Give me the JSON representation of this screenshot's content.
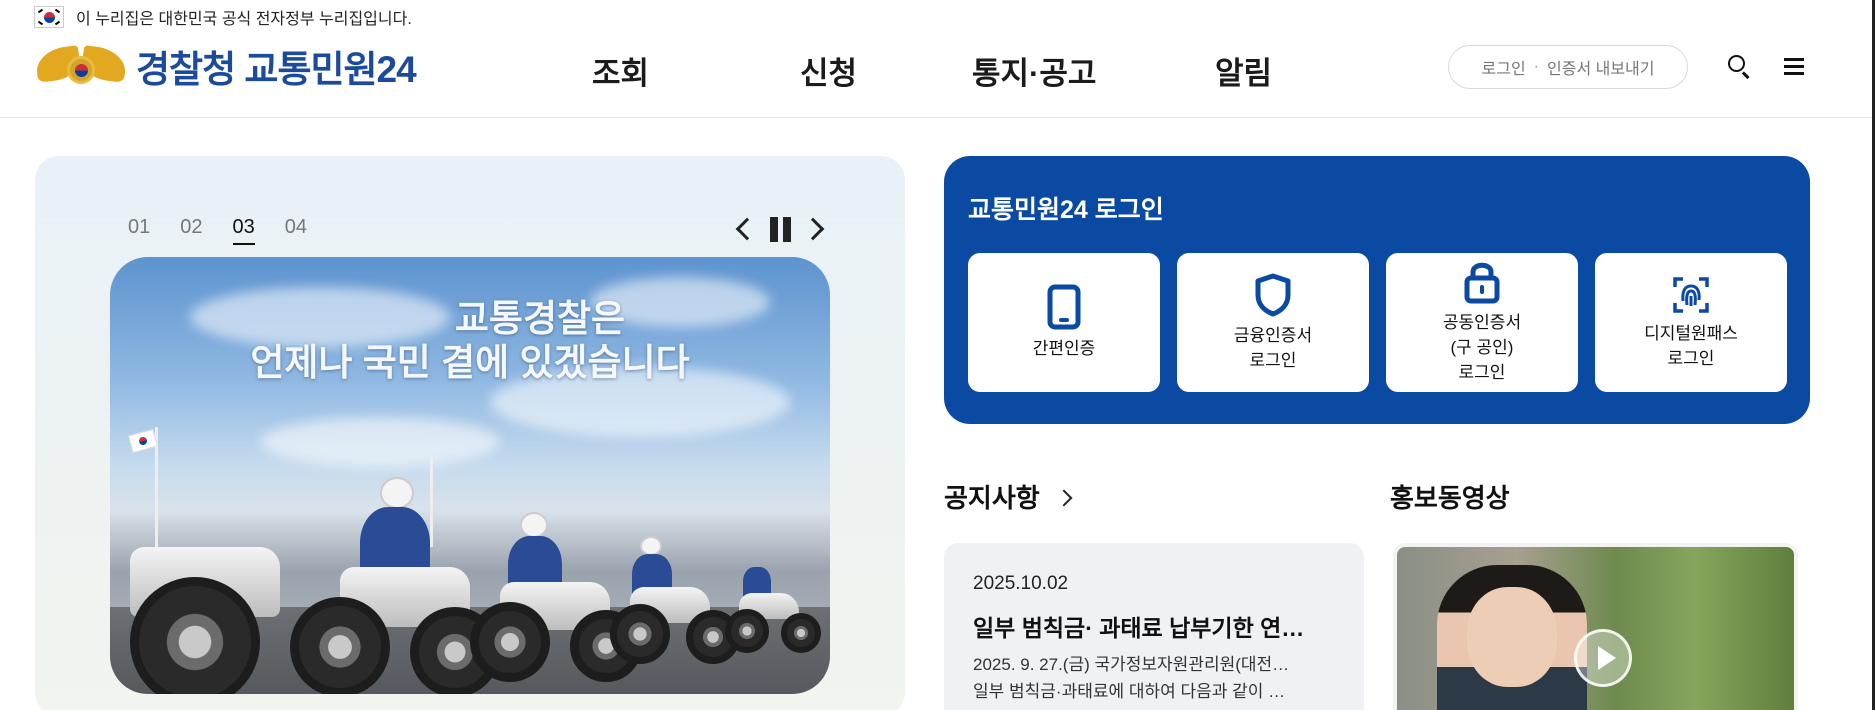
{
  "gov_banner": {
    "text": "이 누리집은 대한민국 공식 전자정부 누리집입니다."
  },
  "header": {
    "logo_text": "경찰청 교통민원24",
    "nav": [
      "조회",
      "신청",
      "통지·공고",
      "알림"
    ],
    "login_label": "로그인",
    "cert_export_label": "인증서 내보내기"
  },
  "hero": {
    "pages": [
      "01",
      "02",
      "03",
      "04"
    ],
    "active_page": "03",
    "banner_line1": "교통경찰은",
    "banner_line2": "언제나 국민 곁에 있겠습니다"
  },
  "login_box": {
    "title": "교통민원24 로그인",
    "options": [
      {
        "label": "간편인증",
        "icon": "phone-icon"
      },
      {
        "label": "금융인증서\n로그인",
        "icon": "shield-icon"
      },
      {
        "label": "공동인증서\n(구 공인)\n로그인",
        "icon": "lock-icon"
      },
      {
        "label": "디지털원패스\n로그인",
        "icon": "fingerprint-icon"
      }
    ]
  },
  "notice": {
    "title": "공지사항",
    "date": "2025.10.02",
    "headline": "일부 범칙금· 과태료 납부기한 연…",
    "body_line1": "2025. 9. 27.(금) 국가정보자원관리원(대전…",
    "body_line2": "일부 범칙금·과태료에 대하여 다음과 같이 …"
  },
  "promo": {
    "title": "홍보동영상"
  },
  "colors": {
    "brand_blue": "#0b4aa2",
    "logo_blue": "#1c4b9c"
  }
}
